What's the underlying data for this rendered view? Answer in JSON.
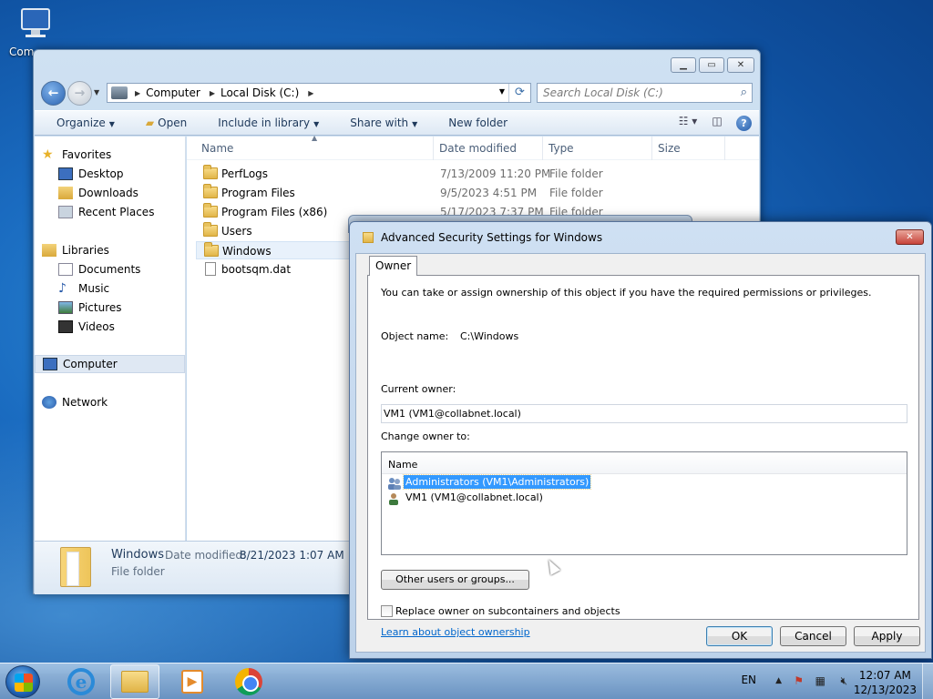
{
  "desktop": {
    "computer_label": "Com"
  },
  "explorer": {
    "breadcrumb": [
      "Computer",
      "Local Disk (C:)"
    ],
    "search_placeholder": "Search Local Disk (C:)",
    "toolbar": {
      "organize": "Organize",
      "open": "Open",
      "include": "Include in library",
      "share": "Share with",
      "new_folder": "New folder"
    },
    "nav": {
      "favorites": "Favorites",
      "favorites_items": [
        "Desktop",
        "Downloads",
        "Recent Places"
      ],
      "libraries": "Libraries",
      "libraries_items": [
        "Documents",
        "Music",
        "Pictures",
        "Videos"
      ],
      "computer": "Computer",
      "network": "Network"
    },
    "columns": {
      "name": "Name",
      "date": "Date modified",
      "type": "Type",
      "size": "Size"
    },
    "files": [
      {
        "name": "PerfLogs",
        "date": "7/13/2009 11:20 PM",
        "type": "File folder",
        "kind": "folder"
      },
      {
        "name": "Program Files",
        "date": "9/5/2023 4:51 PM",
        "type": "File folder",
        "kind": "folder"
      },
      {
        "name": "Program Files (x86)",
        "date": "5/17/2023 7:37 PM",
        "type": "File folder",
        "kind": "folder"
      },
      {
        "name": "Users",
        "date": "",
        "type": "",
        "kind": "folder"
      },
      {
        "name": "Windows",
        "date": "",
        "type": "",
        "kind": "folder"
      },
      {
        "name": "bootsqm.dat",
        "date": "",
        "type": "",
        "kind": "file"
      }
    ],
    "details": {
      "name": "Windows",
      "date_label": "Date modified:",
      "date": "8/21/2023 1:07 AM",
      "type": "File folder"
    }
  },
  "dialog": {
    "title": "Advanced Security Settings for Windows",
    "tab": "Owner",
    "intro": "You can take or assign ownership of this object if you have the required permissions or privileges.",
    "object_name_label": "Object name:",
    "object_name": "C:\\Windows",
    "current_owner_label": "Current owner:",
    "current_owner": "VM1 (VM1@collabnet.local)",
    "change_owner_label": "Change owner to:",
    "list_header": "Name",
    "owners": [
      "Administrators (VM1\\Administrators)",
      "VM1 (VM1@collabnet.local)"
    ],
    "other_users_button": "Other users or groups...",
    "replace_label": "Replace owner on subcontainers and objects",
    "learn_link": "Learn about object ownership",
    "ok": "OK",
    "cancel": "Cancel",
    "apply": "Apply"
  },
  "taskbar": {
    "language": "EN",
    "time": "12:07 AM",
    "date": "12/13/2023"
  }
}
